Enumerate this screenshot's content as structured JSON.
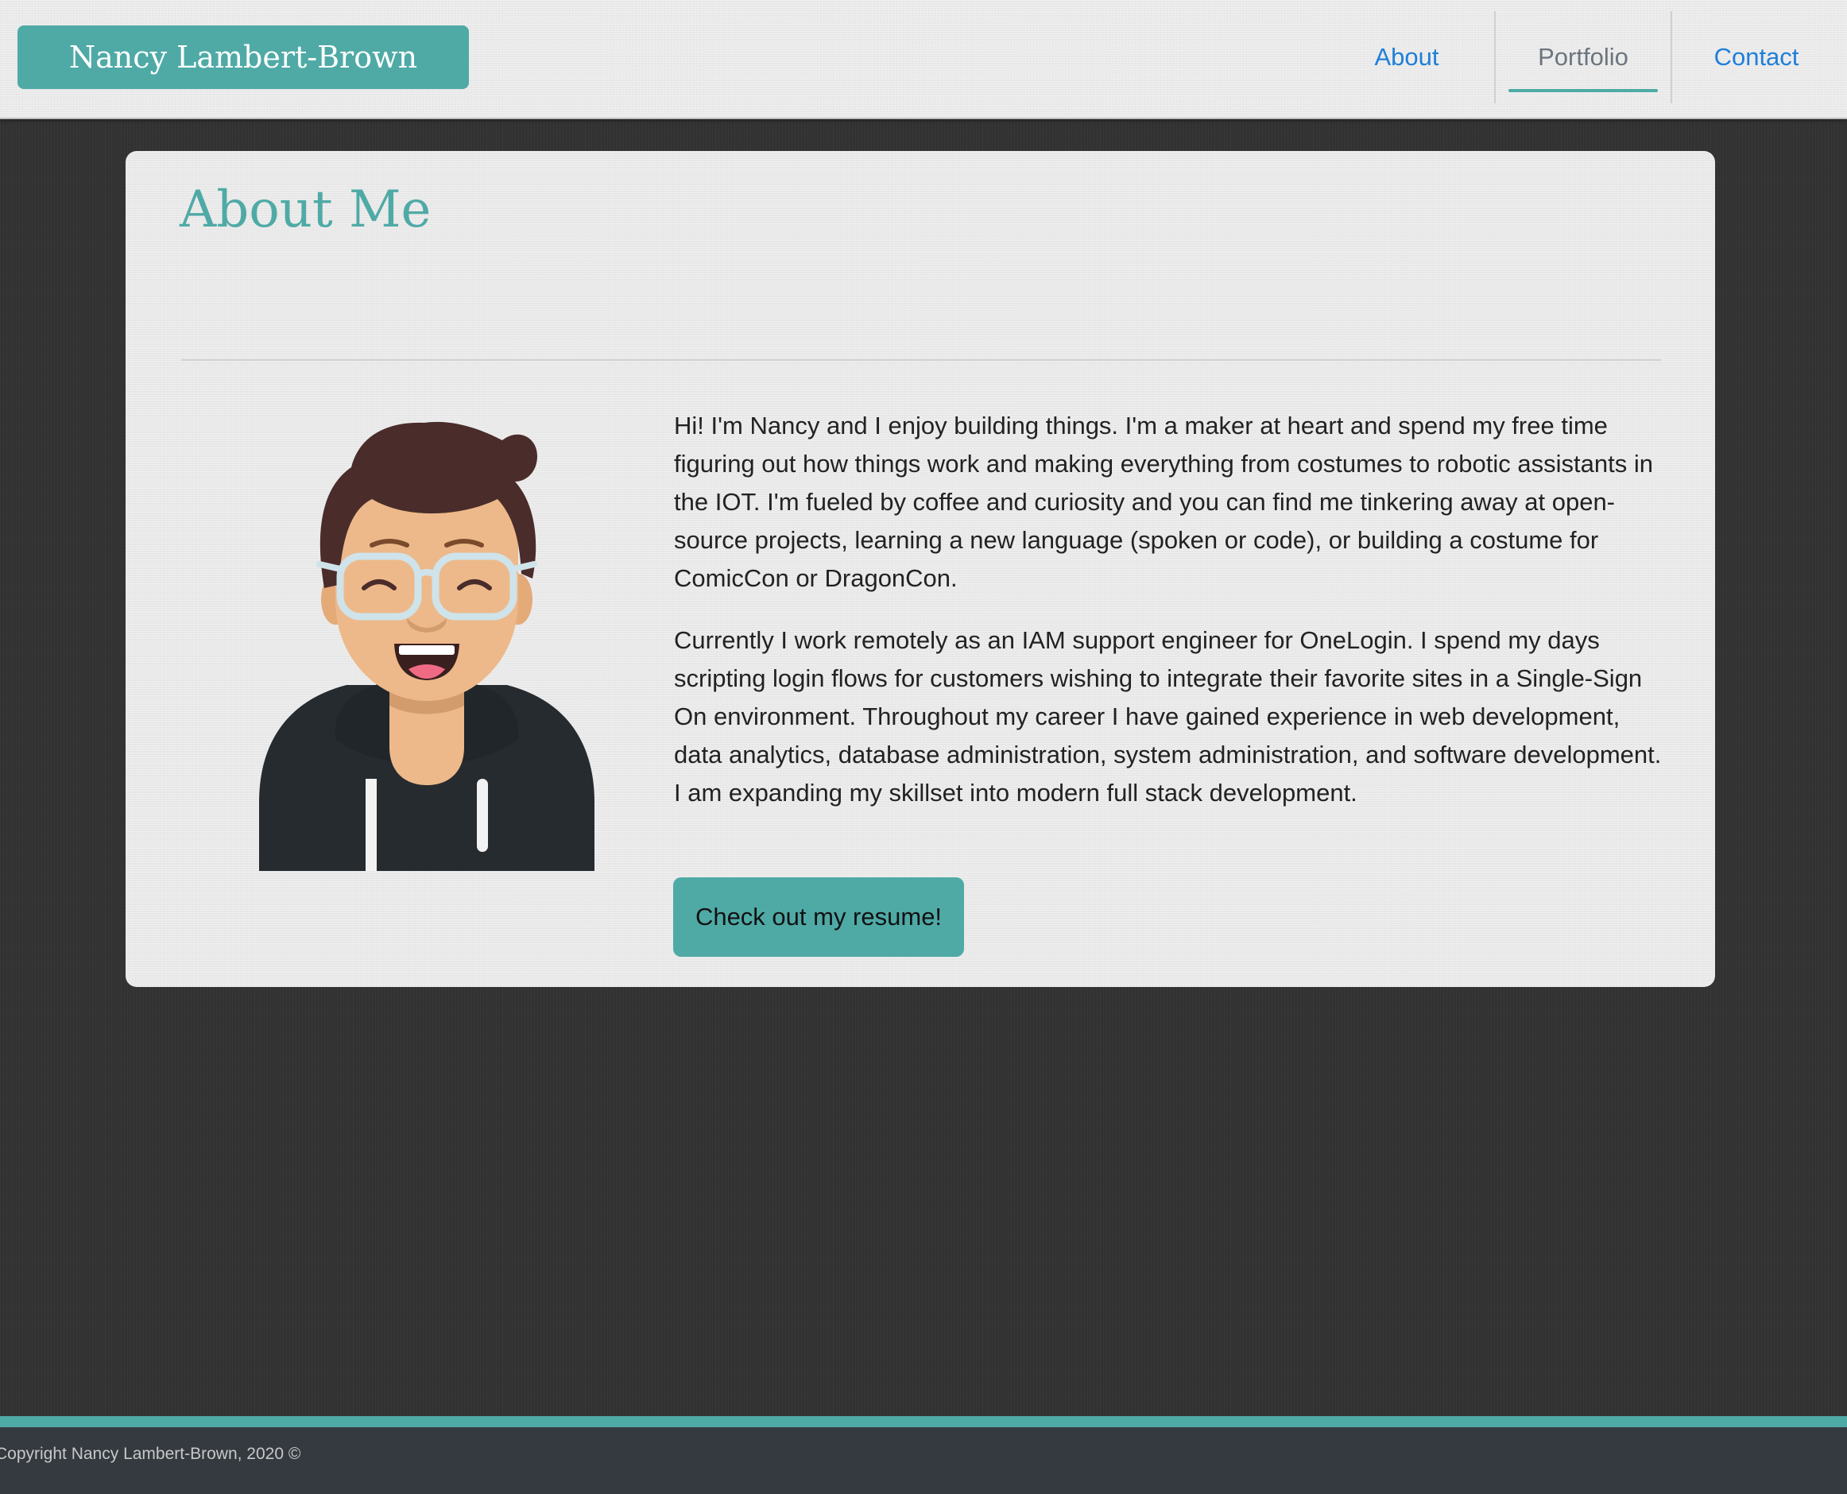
{
  "header": {
    "brand": "Nancy Lambert-Brown",
    "nav": [
      {
        "label": "About"
      },
      {
        "label": "Portfolio"
      },
      {
        "label": "Contact"
      }
    ],
    "active_nav": "Portfolio"
  },
  "main": {
    "title": "About Me",
    "paragraphs": [
      "Hi! I'm Nancy and I enjoy building things. I'm a maker at heart and spend my free time figuring out how things work and making everything from costumes to robotic assistants in the IOT. I'm fueled by coffee and curiosity and you can find me tinkering away at open-source projects, learning a new language (spoken or code), or building a costume for ComicCon or DragonCon.",
      "Currently I work remotely as an IAM support engineer for OneLogin. I spend my days scripting login flows for customers wishing to integrate their favorite sites in a Single-Sign On environment. Throughout my career I have gained experience in web development, data analytics, database administration, system administration, and software development. I am expanding my skillset into modern full stack development."
    ],
    "resume_button": "Check out my resume!",
    "avatar_icon": "avatar-illustration"
  },
  "footer": {
    "copyright": "Copyright Nancy Lambert-Brown, 2020 ©"
  },
  "colors": {
    "accent": "#4faaa6",
    "link": "#1e7fd9",
    "active_link": "#6c757d",
    "footer_bg": "#343a40",
    "page_bg": "#333333"
  }
}
